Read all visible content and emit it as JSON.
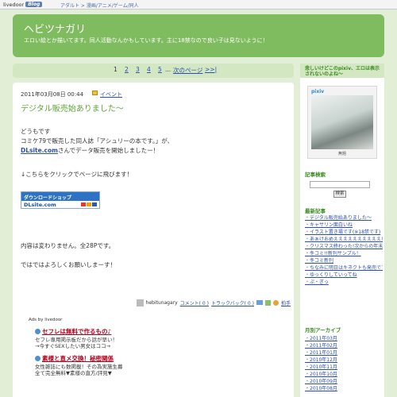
{
  "topbar": {
    "site": "livedoor",
    "blog": "Blog",
    "category": "アダルト > 漫画/アニメ/ゲーム/同人"
  },
  "header": {
    "title": "ヘビツナガリ",
    "description": "エロい絵とか描いてます。同人活動なんかもしています。主に18禁なので良い子は見ないように！"
  },
  "pager": {
    "pages": [
      "1",
      "2",
      "3",
      "4",
      "5",
      "..."
    ],
    "next": "次のページ",
    "last": ">>|"
  },
  "post": {
    "date": "2011年03月08日 00:44",
    "category": "イベント",
    "title": "デジタル販売始ありました〜",
    "lines": {
      "l1": "どうもです",
      "l2": "コミケ79で販売した同人誌「アシュリーの本です。」が、",
      "l3_link": "DLsite.com",
      "l3_rest": "さんでデータ販売を開始しましたー！",
      "l4": "↓こちらをクリックでページに飛びます！",
      "l5": "内容は変わりません。全28Pです。",
      "l6": "ではではよろしくお願いしまーす！"
    },
    "banner": {
      "top": "ダウンロードショップ",
      "bottom": "DLsite.com"
    },
    "footer": {
      "author": "hebitunagary",
      "comments": "コメント( 0 )",
      "trackbacks": "トラックバック( 0 )",
      "clap": "拍手"
    }
  },
  "ads": {
    "header": "Ads by livedoor",
    "items": [
      {
        "title": "セフレは無料で作るもの♪",
        "desc1": "セフレ専用掲示板だから話が早い！",
        "desc2": "→今すぐSEXしたい男女はココ→"
      },
      {
        "title": "素様と直メ交換！秘密関係",
        "desc1": "女性雑誌にも数掲載！その為実施生募",
        "desc2": "全て完全無料▼素様の直方/評見▼"
      }
    ]
  },
  "sidebar": {
    "pixiv": {
      "title": "悲しいけどこのpixiv、エロは表示されないのよね〜",
      "logo": "pixiv",
      "caption": "無題"
    },
    "search": {
      "title": "記事検索",
      "button": "検索",
      "placeholder": ""
    },
    "recent": {
      "title": "最新記事",
      "items": [
        "デジタル販売始ありました〜",
        "キャサリン面白いね",
        "イラスト置き場です(※18禁です)",
        "あぁけおめええええええええええ!!!(ラブラブ)ケアーーー",
        "クリスマス終わった!次からの年末年の大好物だ！",
        "冬コミ!!新刊サンプル！",
        "冬コミ新刊",
        "ちなみに明日はキネクトも発売ですよー",
        "ゆっくりしていってね",
        "ぷ・ぎっ"
      ]
    },
    "archive": {
      "title": "月別アーカイブ",
      "items": [
        "2011年03月",
        "2011年02月",
        "2011年01月",
        "2010年12月",
        "2010年11月",
        "2010年10月",
        "2010年09月",
        "2010年08月"
      ]
    }
  },
  "colors": {
    "background": "#e3eed7",
    "header": "#7fbb5f",
    "accent": "#5ca637",
    "link": "#2c4fb0"
  }
}
